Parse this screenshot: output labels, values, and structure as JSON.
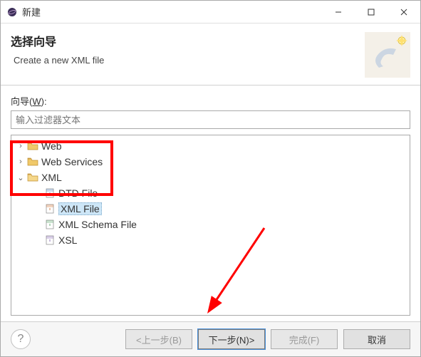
{
  "titlebar": {
    "title": "新建"
  },
  "header": {
    "title": "选择向导",
    "subtitle": "Create a new XML file"
  },
  "wizard": {
    "label_prefix": "向导(",
    "label_key": "W",
    "label_suffix": "):",
    "filter_placeholder": "输入过滤器文本"
  },
  "tree": {
    "items": [
      {
        "label": "Web",
        "level": 1,
        "expanded": false,
        "type": "folder"
      },
      {
        "label": "Web Services",
        "level": 1,
        "expanded": false,
        "type": "folder"
      },
      {
        "label": "XML",
        "level": 1,
        "expanded": true,
        "type": "folder-open"
      },
      {
        "label": "DTD File",
        "level": 2,
        "type": "file-dtd"
      },
      {
        "label": "XML File",
        "level": 2,
        "type": "file-xml",
        "selected": true
      },
      {
        "label": "XML Schema File",
        "level": 2,
        "type": "file-xsd"
      },
      {
        "label": "XSL",
        "level": 2,
        "type": "file-xsl"
      }
    ]
  },
  "buttons": {
    "back": "<上一步(B)",
    "next": "下一步(N)>",
    "finish": "完成(F)",
    "cancel": "取消",
    "help": "?"
  }
}
